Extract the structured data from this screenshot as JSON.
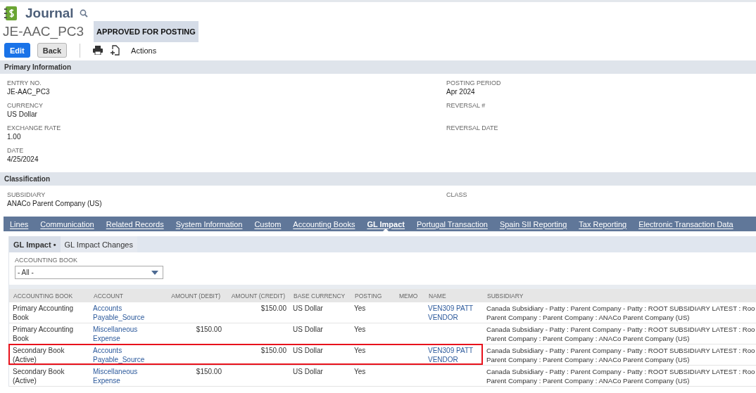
{
  "header": {
    "title": "Journal",
    "record_id": "JE-AAC_PC3",
    "status": "APPROVED FOR POSTING"
  },
  "toolbar": {
    "buttons": [
      {
        "label": "Edit",
        "kind": "primary"
      },
      {
        "label": "Back",
        "kind": "secondary"
      }
    ],
    "actions_label": "Actions"
  },
  "primary_information": {
    "title": "Primary Information",
    "left_fields": [
      {
        "label": "ENTRY NO.",
        "value": "JE-AAC_PC3"
      },
      {
        "label": "CURRENCY",
        "value": "US Dollar"
      },
      {
        "label": "EXCHANGE RATE",
        "value": "1.00"
      },
      {
        "label": "DATE",
        "value": "4/25/2024"
      }
    ],
    "right_fields": [
      {
        "label": "POSTING PERIOD",
        "value": "Apr 2024"
      },
      {
        "label": "REVERSAL #"
      },
      {
        "label": "REVERSAL DATE"
      }
    ]
  },
  "classification": {
    "title": "Classification",
    "left_fields": [
      {
        "label": "SUBSIDIARY",
        "value": "ANACo Parent Company (US)"
      }
    ],
    "right_fields": [
      {
        "label": "CLASS"
      }
    ]
  },
  "tabs": [
    {
      "label": "Lines",
      "selected": false
    },
    {
      "label": "Communication",
      "selected": false
    },
    {
      "label": "Related Records",
      "selected": false
    },
    {
      "label": "System Information",
      "selected": false
    },
    {
      "label": "Custom",
      "selected": false
    },
    {
      "label": "Accounting Books",
      "selected": false
    },
    {
      "label": "GL Impact",
      "selected": true
    },
    {
      "label": "Portugal Transaction",
      "selected": false
    },
    {
      "label": "Spain SII Reporting",
      "selected": false
    },
    {
      "label": "Tax Reporting",
      "selected": false
    },
    {
      "label": "Electronic Transaction Data",
      "selected": false
    }
  ],
  "subtabs": [
    {
      "label": "GL Impact •",
      "selected": true
    },
    {
      "label": "GL Impact Changes",
      "selected": false
    }
  ],
  "filter": {
    "label": "ACCOUNTING BOOK",
    "value": "- All -"
  },
  "table": {
    "columns": [
      "ACCOUNTING BOOK",
      "ACCOUNT",
      "AMOUNT (DEBIT)",
      "AMOUNT (CREDIT)",
      "BASE CURRENCY",
      "POSTING",
      "MEMO",
      "NAME",
      "SUBSIDIARY"
    ],
    "rows": [
      {
        "accounting_book": "Primary Accounting Book",
        "account": "Accounts Payable_Source",
        "debit": "",
        "credit": "$150.00",
        "base_currency": "US Dollar",
        "posting": "Yes",
        "name": "VEN309 PATT VENDOR",
        "subsidiary": [
          "Canada Subsidiary - Patty : Parent Company - Patty : ROOT SUBSIDIARY LATEST : Roo",
          "Parent Company : Parent Company : ANACo Parent Company (US)"
        ],
        "highlighted": false
      },
      {
        "accounting_book": "Primary Accounting Book",
        "account": "Miscellaneous Expense",
        "debit": "$150.00",
        "credit": "",
        "base_currency": "US Dollar",
        "posting": "Yes",
        "name": "",
        "subsidiary": [
          "Canada Subsidiary - Patty : Parent Company - Patty : ROOT SUBSIDIARY LATEST : Roo",
          "Parent Company : Parent Company : ANACo Parent Company (US)"
        ],
        "highlighted": false
      },
      {
        "accounting_book": "Secondary Book (Active)",
        "account": "Accounts Payable_Source",
        "debit": "",
        "credit": "$150.00",
        "base_currency": "US Dollar",
        "posting": "Yes",
        "name": "VEN309 PATT VENDOR",
        "subsidiary": [
          "Canada Subsidiary - Patty : Parent Company - Patty : ROOT SUBSIDIARY LATEST : Roo",
          "Parent Company : Parent Company : ANACo Parent Company (US)"
        ],
        "highlighted": true
      },
      {
        "accounting_book": "Secondary Book (Active)",
        "account": "Miscellaneous Expense",
        "debit": "$150.00",
        "credit": "",
        "base_currency": "US Dollar",
        "posting": "Yes",
        "name": "",
        "subsidiary": [
          "Canada Subsidiary - Patty : Parent Company - Patty : ROOT SUBSIDIARY LATEST : Roo",
          "Parent Company : Parent Company : ANACo Parent Company (US)"
        ],
        "highlighted": false
      }
    ]
  }
}
